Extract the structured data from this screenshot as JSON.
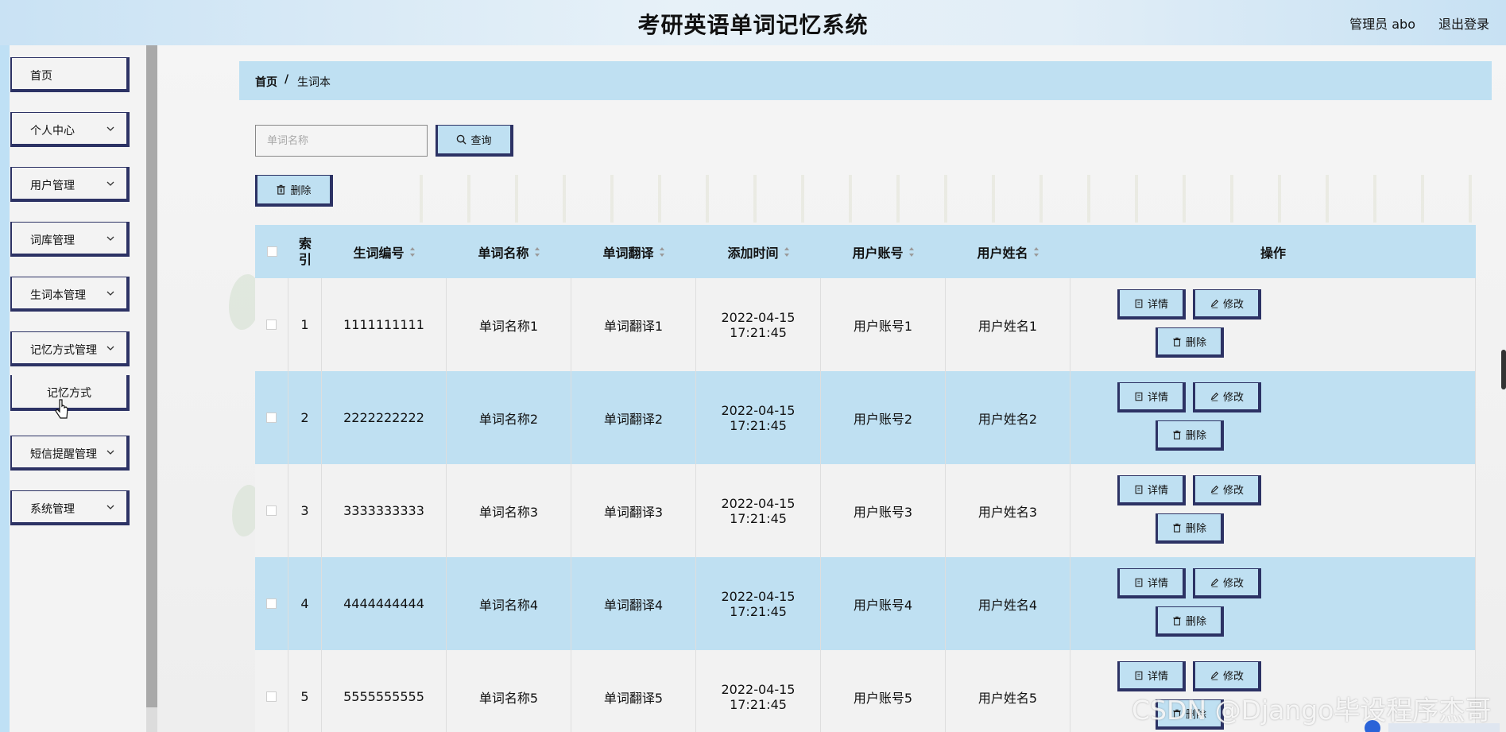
{
  "header": {
    "title": "考研英语单词记忆系统",
    "admin": "管理员 abo",
    "logout": "退出登录"
  },
  "sidebar": {
    "items": [
      {
        "label": "首页",
        "chevron": false
      },
      {
        "label": "个人中心",
        "chevron": true
      },
      {
        "label": "用户管理",
        "chevron": true
      },
      {
        "label": "词库管理",
        "chevron": true
      },
      {
        "label": "生词本管理",
        "chevron": true
      },
      {
        "label": "记忆方式管理",
        "chevron": true
      },
      {
        "label": "短信提醒管理",
        "chevron": true
      },
      {
        "label": "系统管理",
        "chevron": true
      }
    ],
    "subitem": "记忆方式"
  },
  "breadcrumb": {
    "home": "首页",
    "separator": "/",
    "current": "生词本"
  },
  "search": {
    "placeholder": "单词名称",
    "value": "",
    "button": "查询"
  },
  "actions": {
    "delete": "删除"
  },
  "table": {
    "columns": [
      "索引",
      "生词编号",
      "单词名称",
      "单词翻译",
      "添加时间",
      "用户账号",
      "用户姓名",
      "操作"
    ],
    "rows": [
      {
        "index": "1",
        "code": "1111111111",
        "word": "单词名称1",
        "translation": "单词翻译1",
        "time": "2022-04-15 17:21:45",
        "account": "用户账号1",
        "name": "用户姓名1"
      },
      {
        "index": "2",
        "code": "2222222222",
        "word": "单词名称2",
        "translation": "单词翻译2",
        "time": "2022-04-15 17:21:45",
        "account": "用户账号2",
        "name": "用户姓名2"
      },
      {
        "index": "3",
        "code": "3333333333",
        "word": "单词名称3",
        "translation": "单词翻译3",
        "time": "2022-04-15 17:21:45",
        "account": "用户账号3",
        "name": "用户姓名3"
      },
      {
        "index": "4",
        "code": "4444444444",
        "word": "单词名称4",
        "translation": "单词翻译4",
        "time": "2022-04-15 17:21:45",
        "account": "用户账号4",
        "name": "用户姓名4"
      },
      {
        "index": "5",
        "code": "5555555555",
        "word": "单词名称5",
        "translation": "单词翻译5",
        "time": "2022-04-15 17:21:45",
        "account": "用户账号5",
        "name": "用户姓名5"
      }
    ],
    "ops": {
      "detail": "详情",
      "edit": "修改",
      "delete": "删除"
    }
  },
  "watermark": "CSDN @Django毕设程序杰哥",
  "colors": {
    "accent": "#bfe0f2",
    "border": "#2c3264",
    "row_light": "#f2f2f2"
  }
}
